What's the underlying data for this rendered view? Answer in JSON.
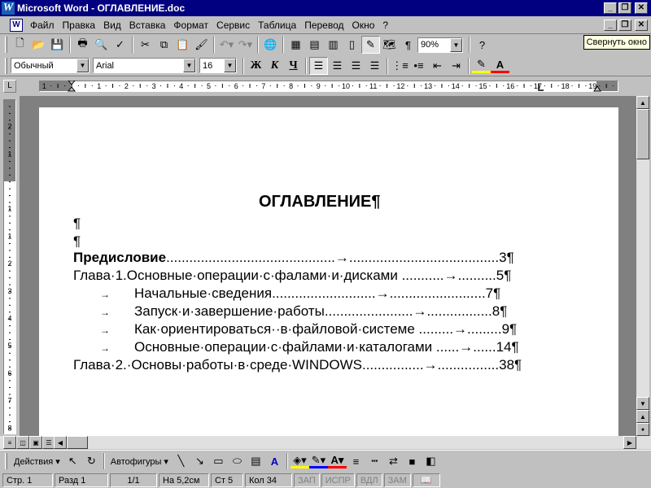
{
  "window": {
    "app_icon": "W",
    "title": "Microsoft Word - ОГЛАВЛЕНИЕ.doc",
    "minimize": "_",
    "restore": "❐",
    "close": "✕"
  },
  "menu": {
    "doc_icon": "W",
    "items": [
      "Файл",
      "Правка",
      "Вид",
      "Вставка",
      "Формат",
      "Сервис",
      "Таблица",
      "Перевод",
      "Окно",
      "?"
    ],
    "doc_minimize": "_",
    "doc_restore": "❐",
    "doc_close": "✕"
  },
  "toolbar_standard": {
    "zoom": "90%",
    "tooltip": "Свернуть окно"
  },
  "toolbar_format": {
    "style": "Обычный",
    "font": "Arial",
    "size": "16",
    "bold": "Ж",
    "italic": "К",
    "underline": "Ч"
  },
  "ruler": {
    "corner": "L",
    "labels": [
      "1",
      "1",
      "2",
      "3",
      "4",
      "5",
      "6",
      "7",
      "8",
      "9",
      "10",
      "11",
      "12",
      "13",
      "14",
      "15",
      "16",
      "17",
      "18",
      "19"
    ],
    "vlabels": [
      "2",
      "1",
      "1",
      "1",
      "2",
      "3",
      "4",
      "5",
      "6",
      "7",
      "8",
      "9"
    ]
  },
  "document": {
    "title": "ОГЛАВЛЕНИЕ¶",
    "empty1": "¶",
    "empty2": "¶",
    "lines": [
      {
        "text": "Предисловие",
        "leader": "............................................→.......................................",
        "page": "3¶",
        "bold": true,
        "indent": false
      },
      {
        "text": "Глава·1.Основные·операции·с·фалами·и·дисками",
        "leader": " ...........→..........",
        "page": "5¶",
        "bold": false,
        "indent": false
      },
      {
        "text": "Начальные·сведения",
        "leader": "...........................→.........................",
        "page": "7¶",
        "bold": false,
        "indent": true
      },
      {
        "text": "Запуск·и·завершение·работы",
        "leader": ".......................→.................",
        "page": "8¶",
        "bold": false,
        "indent": true
      },
      {
        "text": "Как·ориентироваться··в·файловой·системе",
        "leader": " .........→.........",
        "page": "9¶",
        "bold": false,
        "indent": true
      },
      {
        "text": "Основные·операции·с·файлами·и·каталогами",
        "leader": " ......→......",
        "page": "14¶",
        "bold": false,
        "indent": true
      },
      {
        "text": "Глава·2.·Основы·работы·в·среде·WINDOWS",
        "leader": "................→................",
        "page": "38¶",
        "bold": false,
        "indent": false
      }
    ],
    "tab_arrow": "→"
  },
  "drawbar": {
    "actions": "Действия",
    "autoshapes": "Автофигуры"
  },
  "status": {
    "page": "Стр. 1",
    "section": "Разд 1",
    "pages": "1/1",
    "at": "На 5,2см",
    "line": "Ст 5",
    "col": "Кол 34",
    "rec": "ЗАП",
    "trk": "ИСПР",
    "ext": "ВДЛ",
    "ovr": "ЗАМ"
  },
  "colors": {
    "titlebar": "#000080",
    "face": "#c0c0c0",
    "font_color": "#ff0000",
    "highlight": "#ffff00"
  }
}
